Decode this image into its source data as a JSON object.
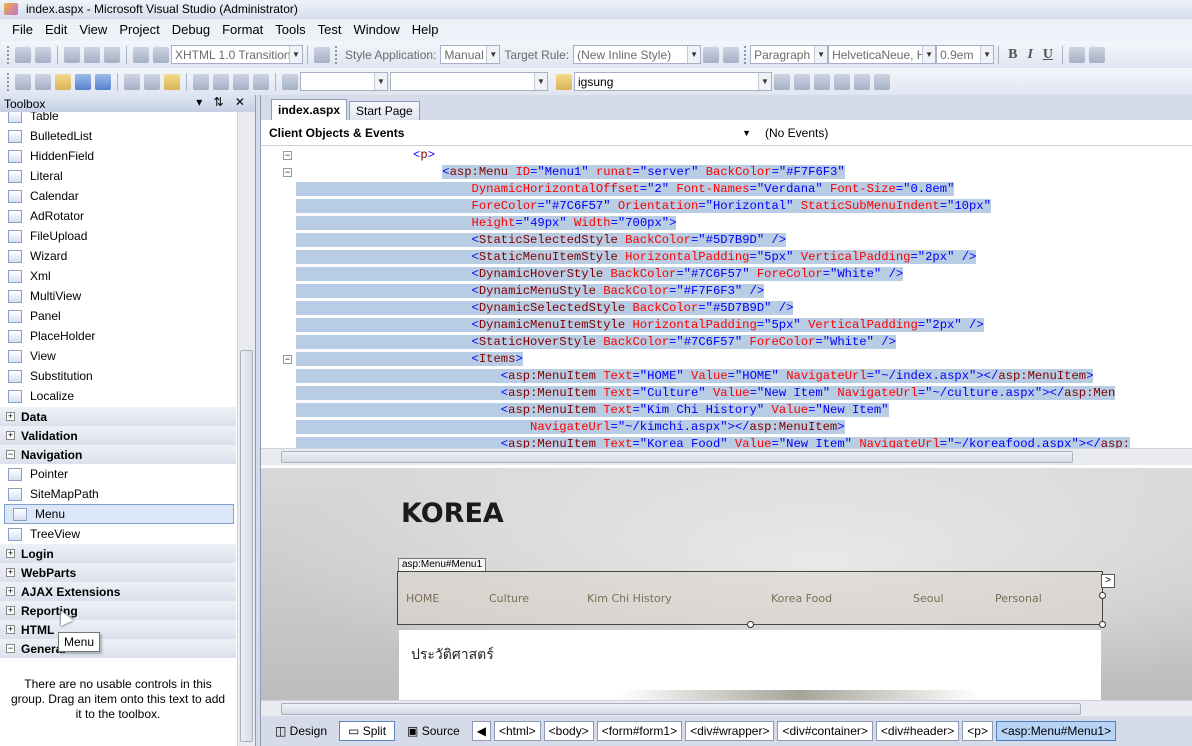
{
  "window": {
    "title": "index.aspx - Microsoft Visual Studio (Administrator)"
  },
  "menubar": [
    "File",
    "Edit",
    "View",
    "Project",
    "Debug",
    "Format",
    "Tools",
    "Test",
    "Window",
    "Help"
  ],
  "toolbar1": {
    "doctype": "XHTML 1.0 Transitionä",
    "style_application_label": "Style Application:",
    "style_application_value": "Manual",
    "target_rule_label": "Target Rule:",
    "target_rule_value": "(New Inline Style)",
    "block_format": "Paragraph",
    "font_name": "HelveticaNeue, H",
    "font_size": "0.9em",
    "bold": "B",
    "italic": "I",
    "underline": "U"
  },
  "toolbar2": {
    "solution_config": "",
    "platform": "",
    "find_value": "igsung"
  },
  "toolbox": {
    "title": "Toolbox",
    "controls": "▾  ̲̲  ✕",
    "items": [
      {
        "label": "Table",
        "top": 0
      },
      {
        "label": "BulletedList"
      },
      {
        "label": "HiddenField"
      },
      {
        "label": "Literal"
      },
      {
        "label": "Calendar"
      },
      {
        "label": "AdRotator"
      },
      {
        "label": "FileUpload"
      },
      {
        "label": "Wizard"
      },
      {
        "label": "Xml"
      },
      {
        "label": "MultiView"
      },
      {
        "label": "Panel"
      },
      {
        "label": "PlaceHolder"
      },
      {
        "label": "View"
      },
      {
        "label": "Substitution"
      },
      {
        "label": "Localize"
      }
    ],
    "groups_before_nav": [
      "Data",
      "Validation"
    ],
    "navigation_group": "Navigation",
    "navigation_items": [
      "Pointer",
      "SiteMapPath",
      "Menu",
      "TreeView"
    ],
    "groups_after_nav": [
      "Login",
      "WebParts",
      "AJAX Extensions",
      "Reporting",
      "HTML",
      "General"
    ],
    "empty_message": "There are no usable controls in this group. Drag an item onto this text to add it to the toolbox.",
    "tooltip": "Menu"
  },
  "editor": {
    "tabs": [
      "index.aspx",
      "Start Page"
    ],
    "client_objects": "Client Objects & Events",
    "events": "(No Events)",
    "code_lines": [
      {
        "indent": "                ",
        "parts": [
          [
            "p",
            "<"
          ],
          [
            "t",
            "p"
          ],
          [
            "p",
            ">"
          ]
        ],
        "sel": false
      },
      {
        "indent": "                    ",
        "parts": [
          [
            "p",
            "<"
          ],
          [
            "t",
            "asp:Menu"
          ],
          [
            "x",
            " "
          ],
          [
            "a",
            "ID"
          ],
          [
            "p",
            "=\""
          ],
          [
            "v",
            "Menu1"
          ],
          [
            "p",
            "\""
          ],
          [
            "x",
            " "
          ],
          [
            "a",
            "runat"
          ],
          [
            "p",
            "=\""
          ],
          [
            "v",
            "server"
          ],
          [
            "p",
            "\""
          ],
          [
            "x",
            " "
          ],
          [
            "a",
            "BackColor"
          ],
          [
            "p",
            "=\""
          ],
          [
            "v",
            "#F7F6F3"
          ],
          [
            "p",
            "\""
          ]
        ],
        "sel": true
      },
      {
        "indent": "                        ",
        "parts": [
          [
            "a",
            "DynamicHorizontalOffset"
          ],
          [
            "p",
            "=\""
          ],
          [
            "v",
            "2"
          ],
          [
            "p",
            "\""
          ],
          [
            "x",
            " "
          ],
          [
            "a",
            "Font-Names"
          ],
          [
            "p",
            "=\""
          ],
          [
            "v",
            "Verdana"
          ],
          [
            "p",
            "\""
          ],
          [
            "x",
            " "
          ],
          [
            "a",
            "Font-Size"
          ],
          [
            "p",
            "=\""
          ],
          [
            "v",
            "0.8em"
          ],
          [
            "p",
            "\""
          ]
        ],
        "sel": true
      },
      {
        "indent": "                        ",
        "parts": [
          [
            "a",
            "ForeColor"
          ],
          [
            "p",
            "=\""
          ],
          [
            "v",
            "#7C6F57"
          ],
          [
            "p",
            "\""
          ],
          [
            "x",
            " "
          ],
          [
            "a",
            "Orientation"
          ],
          [
            "p",
            "=\""
          ],
          [
            "v",
            "Horizontal"
          ],
          [
            "p",
            "\""
          ],
          [
            "x",
            " "
          ],
          [
            "a",
            "StaticSubMenuIndent"
          ],
          [
            "p",
            "=\""
          ],
          [
            "v",
            "10px"
          ],
          [
            "p",
            "\""
          ]
        ],
        "sel": true
      },
      {
        "indent": "                        ",
        "parts": [
          [
            "a",
            "Height"
          ],
          [
            "p",
            "=\""
          ],
          [
            "v",
            "49px"
          ],
          [
            "p",
            "\""
          ],
          [
            "x",
            " "
          ],
          [
            "a",
            "Width"
          ],
          [
            "p",
            "=\""
          ],
          [
            "v",
            "700px"
          ],
          [
            "p",
            "\">"
          ]
        ],
        "sel": true
      },
      {
        "indent": "                        ",
        "parts": [
          [
            "p",
            "<"
          ],
          [
            "t",
            "StaticSelectedStyle"
          ],
          [
            "x",
            " "
          ],
          [
            "a",
            "BackColor"
          ],
          [
            "p",
            "=\""
          ],
          [
            "v",
            "#5D7B9D"
          ],
          [
            "p",
            "\""
          ],
          [
            "x",
            " "
          ],
          [
            "p",
            "/>"
          ]
        ],
        "sel": true
      },
      {
        "indent": "                        ",
        "parts": [
          [
            "p",
            "<"
          ],
          [
            "t",
            "StaticMenuItemStyle"
          ],
          [
            "x",
            " "
          ],
          [
            "a",
            "HorizontalPadding"
          ],
          [
            "p",
            "=\""
          ],
          [
            "v",
            "5px"
          ],
          [
            "p",
            "\""
          ],
          [
            "x",
            " "
          ],
          [
            "a",
            "VerticalPadding"
          ],
          [
            "p",
            "=\""
          ],
          [
            "v",
            "2px"
          ],
          [
            "p",
            "\""
          ],
          [
            "x",
            " "
          ],
          [
            "p",
            "/>"
          ]
        ],
        "sel": true
      },
      {
        "indent": "                        ",
        "parts": [
          [
            "p",
            "<"
          ],
          [
            "t",
            "DynamicHoverStyle"
          ],
          [
            "x",
            " "
          ],
          [
            "a",
            "BackColor"
          ],
          [
            "p",
            "=\""
          ],
          [
            "v",
            "#7C6F57"
          ],
          [
            "p",
            "\""
          ],
          [
            "x",
            " "
          ],
          [
            "a",
            "ForeColor"
          ],
          [
            "p",
            "=\""
          ],
          [
            "v",
            "White"
          ],
          [
            "p",
            "\""
          ],
          [
            "x",
            " "
          ],
          [
            "p",
            "/>"
          ]
        ],
        "sel": true
      },
      {
        "indent": "                        ",
        "parts": [
          [
            "p",
            "<"
          ],
          [
            "t",
            "DynamicMenuStyle"
          ],
          [
            "x",
            " "
          ],
          [
            "a",
            "BackColor"
          ],
          [
            "p",
            "=\""
          ],
          [
            "v",
            "#F7F6F3"
          ],
          [
            "p",
            "\""
          ],
          [
            "x",
            " "
          ],
          [
            "p",
            "/>"
          ]
        ],
        "sel": true
      },
      {
        "indent": "                        ",
        "parts": [
          [
            "p",
            "<"
          ],
          [
            "t",
            "DynamicSelectedStyle"
          ],
          [
            "x",
            " "
          ],
          [
            "a",
            "BackColor"
          ],
          [
            "p",
            "=\""
          ],
          [
            "v",
            "#5D7B9D"
          ],
          [
            "p",
            "\""
          ],
          [
            "x",
            " "
          ],
          [
            "p",
            "/>"
          ]
        ],
        "sel": true
      },
      {
        "indent": "                        ",
        "parts": [
          [
            "p",
            "<"
          ],
          [
            "t",
            "DynamicMenuItemStyle"
          ],
          [
            "x",
            " "
          ],
          [
            "a",
            "HorizontalPadding"
          ],
          [
            "p",
            "=\""
          ],
          [
            "v",
            "5px"
          ],
          [
            "p",
            "\""
          ],
          [
            "x",
            " "
          ],
          [
            "a",
            "VerticalPadding"
          ],
          [
            "p",
            "=\""
          ],
          [
            "v",
            "2px"
          ],
          [
            "p",
            "\""
          ],
          [
            "x",
            " "
          ],
          [
            "p",
            "/>"
          ]
        ],
        "sel": true
      },
      {
        "indent": "                        ",
        "parts": [
          [
            "p",
            "<"
          ],
          [
            "t",
            "StaticHoverStyle"
          ],
          [
            "x",
            " "
          ],
          [
            "a",
            "BackColor"
          ],
          [
            "p",
            "=\""
          ],
          [
            "v",
            "#7C6F57"
          ],
          [
            "p",
            "\""
          ],
          [
            "x",
            " "
          ],
          [
            "a",
            "ForeColor"
          ],
          [
            "p",
            "=\""
          ],
          [
            "v",
            "White"
          ],
          [
            "p",
            "\""
          ],
          [
            "x",
            " "
          ],
          [
            "p",
            "/>"
          ]
        ],
        "sel": true
      },
      {
        "indent": "                        ",
        "parts": [
          [
            "p",
            "<"
          ],
          [
            "t",
            "Items"
          ],
          [
            "p",
            ">"
          ]
        ],
        "sel": true
      },
      {
        "indent": "                            ",
        "parts": [
          [
            "p",
            "<"
          ],
          [
            "t",
            "asp:MenuItem"
          ],
          [
            "x",
            " "
          ],
          [
            "a",
            "Text"
          ],
          [
            "p",
            "=\""
          ],
          [
            "v",
            "HOME"
          ],
          [
            "p",
            "\""
          ],
          [
            "x",
            " "
          ],
          [
            "a",
            "Value"
          ],
          [
            "p",
            "=\""
          ],
          [
            "v",
            "HOME"
          ],
          [
            "p",
            "\""
          ],
          [
            "x",
            " "
          ],
          [
            "a",
            "NavigateUrl"
          ],
          [
            "p",
            "=\""
          ],
          [
            "v",
            "~/index.aspx"
          ],
          [
            "p",
            "\"></"
          ],
          [
            "t",
            "asp:MenuItem"
          ],
          [
            "p",
            ">"
          ]
        ],
        "sel": true
      },
      {
        "indent": "                            ",
        "parts": [
          [
            "p",
            "<"
          ],
          [
            "t",
            "asp:MenuItem"
          ],
          [
            "x",
            " "
          ],
          [
            "a",
            "Text"
          ],
          [
            "p",
            "=\""
          ],
          [
            "v",
            "Culture"
          ],
          [
            "p",
            "\""
          ],
          [
            "x",
            " "
          ],
          [
            "a",
            "Value"
          ],
          [
            "p",
            "=\""
          ],
          [
            "v",
            "New Item"
          ],
          [
            "p",
            "\""
          ],
          [
            "x",
            " "
          ],
          [
            "a",
            "NavigateUrl"
          ],
          [
            "p",
            "=\""
          ],
          [
            "v",
            "~/culture.aspx"
          ],
          [
            "p",
            "\"></"
          ],
          [
            "t",
            "asp:Men"
          ]
        ],
        "sel": true
      },
      {
        "indent": "                            ",
        "parts": [
          [
            "p",
            "<"
          ],
          [
            "t",
            "asp:MenuItem"
          ],
          [
            "x",
            " "
          ],
          [
            "a",
            "Text"
          ],
          [
            "p",
            "=\""
          ],
          [
            "v",
            "Kim Chi History"
          ],
          [
            "p",
            "\""
          ],
          [
            "x",
            " "
          ],
          [
            "a",
            "Value"
          ],
          [
            "p",
            "=\""
          ],
          [
            "v",
            "New Item"
          ],
          [
            "p",
            "\""
          ]
        ],
        "sel": true
      },
      {
        "indent": "                                ",
        "parts": [
          [
            "a",
            "NavigateUrl"
          ],
          [
            "p",
            "=\""
          ],
          [
            "v",
            "~/kimchi.aspx"
          ],
          [
            "p",
            "\"></"
          ],
          [
            "t",
            "asp:MenuItem"
          ],
          [
            "p",
            ">"
          ]
        ],
        "sel": true
      },
      {
        "indent": "                            ",
        "parts": [
          [
            "p",
            "<"
          ],
          [
            "t",
            "asp:MenuItem"
          ],
          [
            "x",
            " "
          ],
          [
            "a",
            "Text"
          ],
          [
            "p",
            "=\""
          ],
          [
            "v",
            "Korea Food"
          ],
          [
            "p",
            "\""
          ],
          [
            "x",
            " "
          ],
          [
            "a",
            "Value"
          ],
          [
            "p",
            "=\""
          ],
          [
            "v",
            "New Item"
          ],
          [
            "p",
            "\""
          ],
          [
            "x",
            " "
          ],
          [
            "a",
            "NavigateUrl"
          ],
          [
            "p",
            "=\""
          ],
          [
            "v",
            "~/koreafood.aspx"
          ],
          [
            "p",
            "\"></"
          ],
          [
            "t",
            "asp:"
          ]
        ],
        "sel": true
      }
    ]
  },
  "design": {
    "brand": "KOREA",
    "menu_tag": "asp:Menu#Menu1",
    "menu_items": [
      "HOME",
      "Culture",
      "Kim Chi History",
      "Korea Food",
      "Seoul",
      "Personal"
    ],
    "heading_thai": "ประวัติศาสตร์",
    "smart_tag": ">"
  },
  "bottombar": {
    "views": [
      "Design",
      "Split",
      "Source"
    ],
    "crumbs": [
      "<html>",
      "<body>",
      "<form#form1>",
      "<div#wrapper>",
      "<div#container>",
      "<div#header>",
      "<p>",
      "<asp:Menu#Menu1>"
    ]
  }
}
